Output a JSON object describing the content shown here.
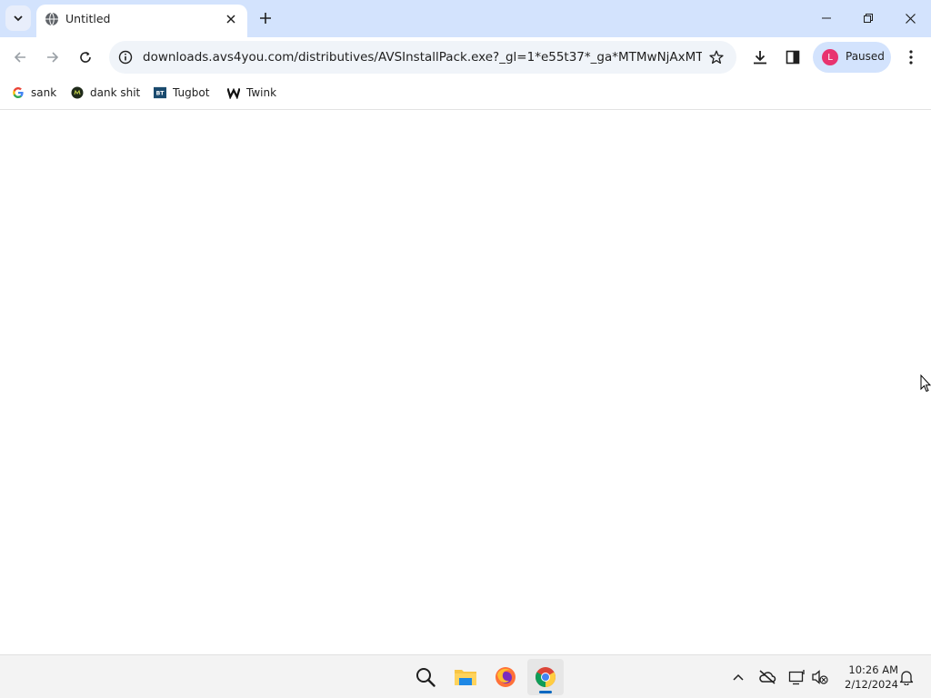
{
  "browser": {
    "tab": {
      "title": "Untitled"
    },
    "address_bar": {
      "url": "downloads.avs4you.com/distributives/AVSInstallPack.exe?_gl=1*e55t37*_ga*MTMwNjAxMTM4Ny..."
    },
    "profile": {
      "initial": "L",
      "status": "Paused"
    },
    "bookmarks": [
      {
        "label": "sank",
        "icon": "google-icon"
      },
      {
        "label": "dank shit",
        "icon": "dank-site-icon"
      },
      {
        "label": "Tugbot",
        "icon": "bt-site-icon"
      },
      {
        "label": "Twink",
        "icon": "w-site-icon"
      }
    ],
    "colors": {
      "tabstrip": "#d3e3fd",
      "omnibox": "#f0f4f9",
      "avatar": "#e8336f"
    }
  },
  "taskbar": {
    "apps": [
      "search-icon",
      "file-explorer-icon",
      "firefox-icon",
      "chrome-icon"
    ],
    "tray": [
      "chevron-up-icon",
      "onedrive-offline-icon",
      "network-icon",
      "volume-muted-icon",
      "notification-bell-icon"
    ],
    "clock": {
      "time": "10:26 AM",
      "date": "2/12/2024"
    }
  }
}
